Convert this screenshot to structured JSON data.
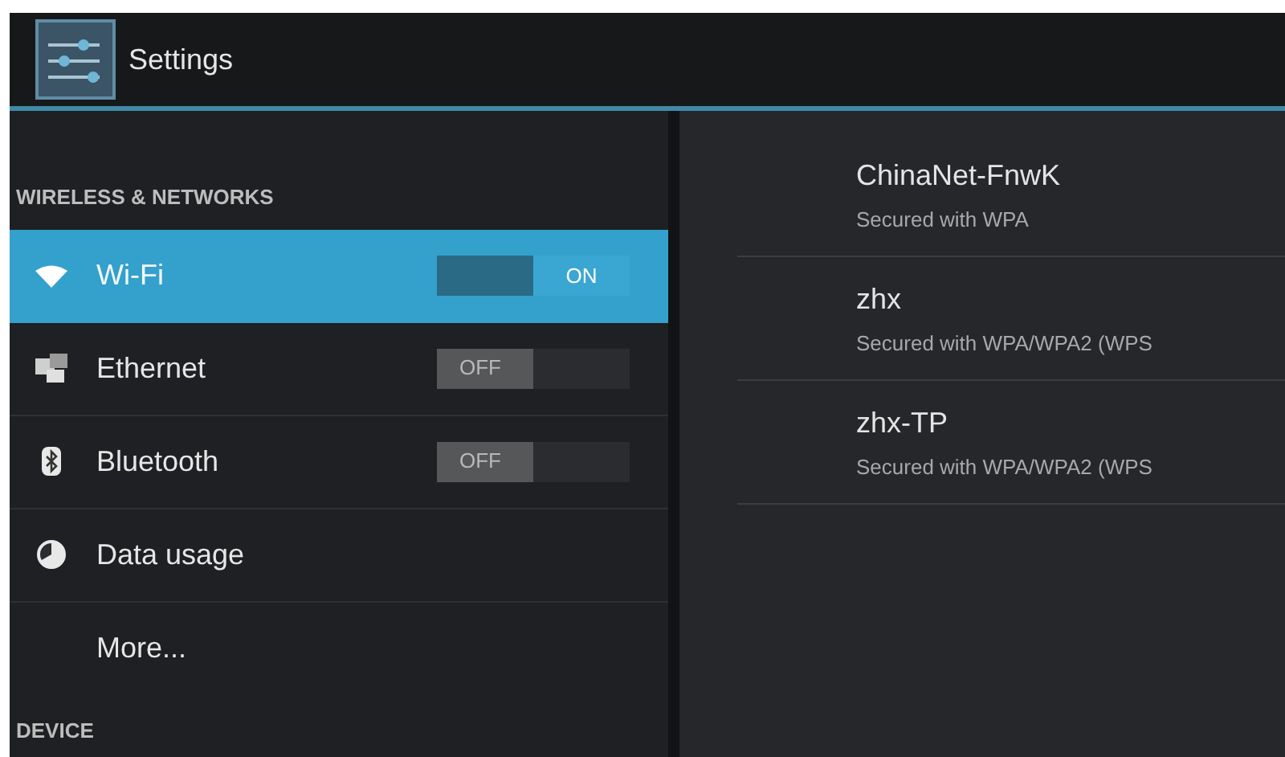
{
  "action_bar": {
    "title": "Settings"
  },
  "sidebar": {
    "sections": [
      {
        "header": "WIRELESS & NETWORKS",
        "items": [
          {
            "kind": "toggle",
            "label": "Wi-Fi",
            "selected": true,
            "on": true,
            "switch_text": "ON"
          },
          {
            "kind": "toggle",
            "label": "Ethernet",
            "selected": false,
            "on": false,
            "switch_text": "OFF"
          },
          {
            "kind": "toggle",
            "label": "Bluetooth",
            "selected": false,
            "on": false,
            "switch_text": "OFF"
          },
          {
            "kind": "plain",
            "label": "Data usage",
            "selected": false
          },
          {
            "kind": "plain",
            "label": "More...",
            "selected": false
          }
        ]
      },
      {
        "header": "DEVICE"
      }
    ]
  },
  "networks": [
    {
      "name": "ChinaNet-FnwK",
      "status": "Secured with WPA"
    },
    {
      "name": "zhx",
      "status": "Secured with WPA/WPA2 (WPS"
    },
    {
      "name": "zhx-TP",
      "status": "Secured with WPA/WPA2 (WPS"
    }
  ]
}
